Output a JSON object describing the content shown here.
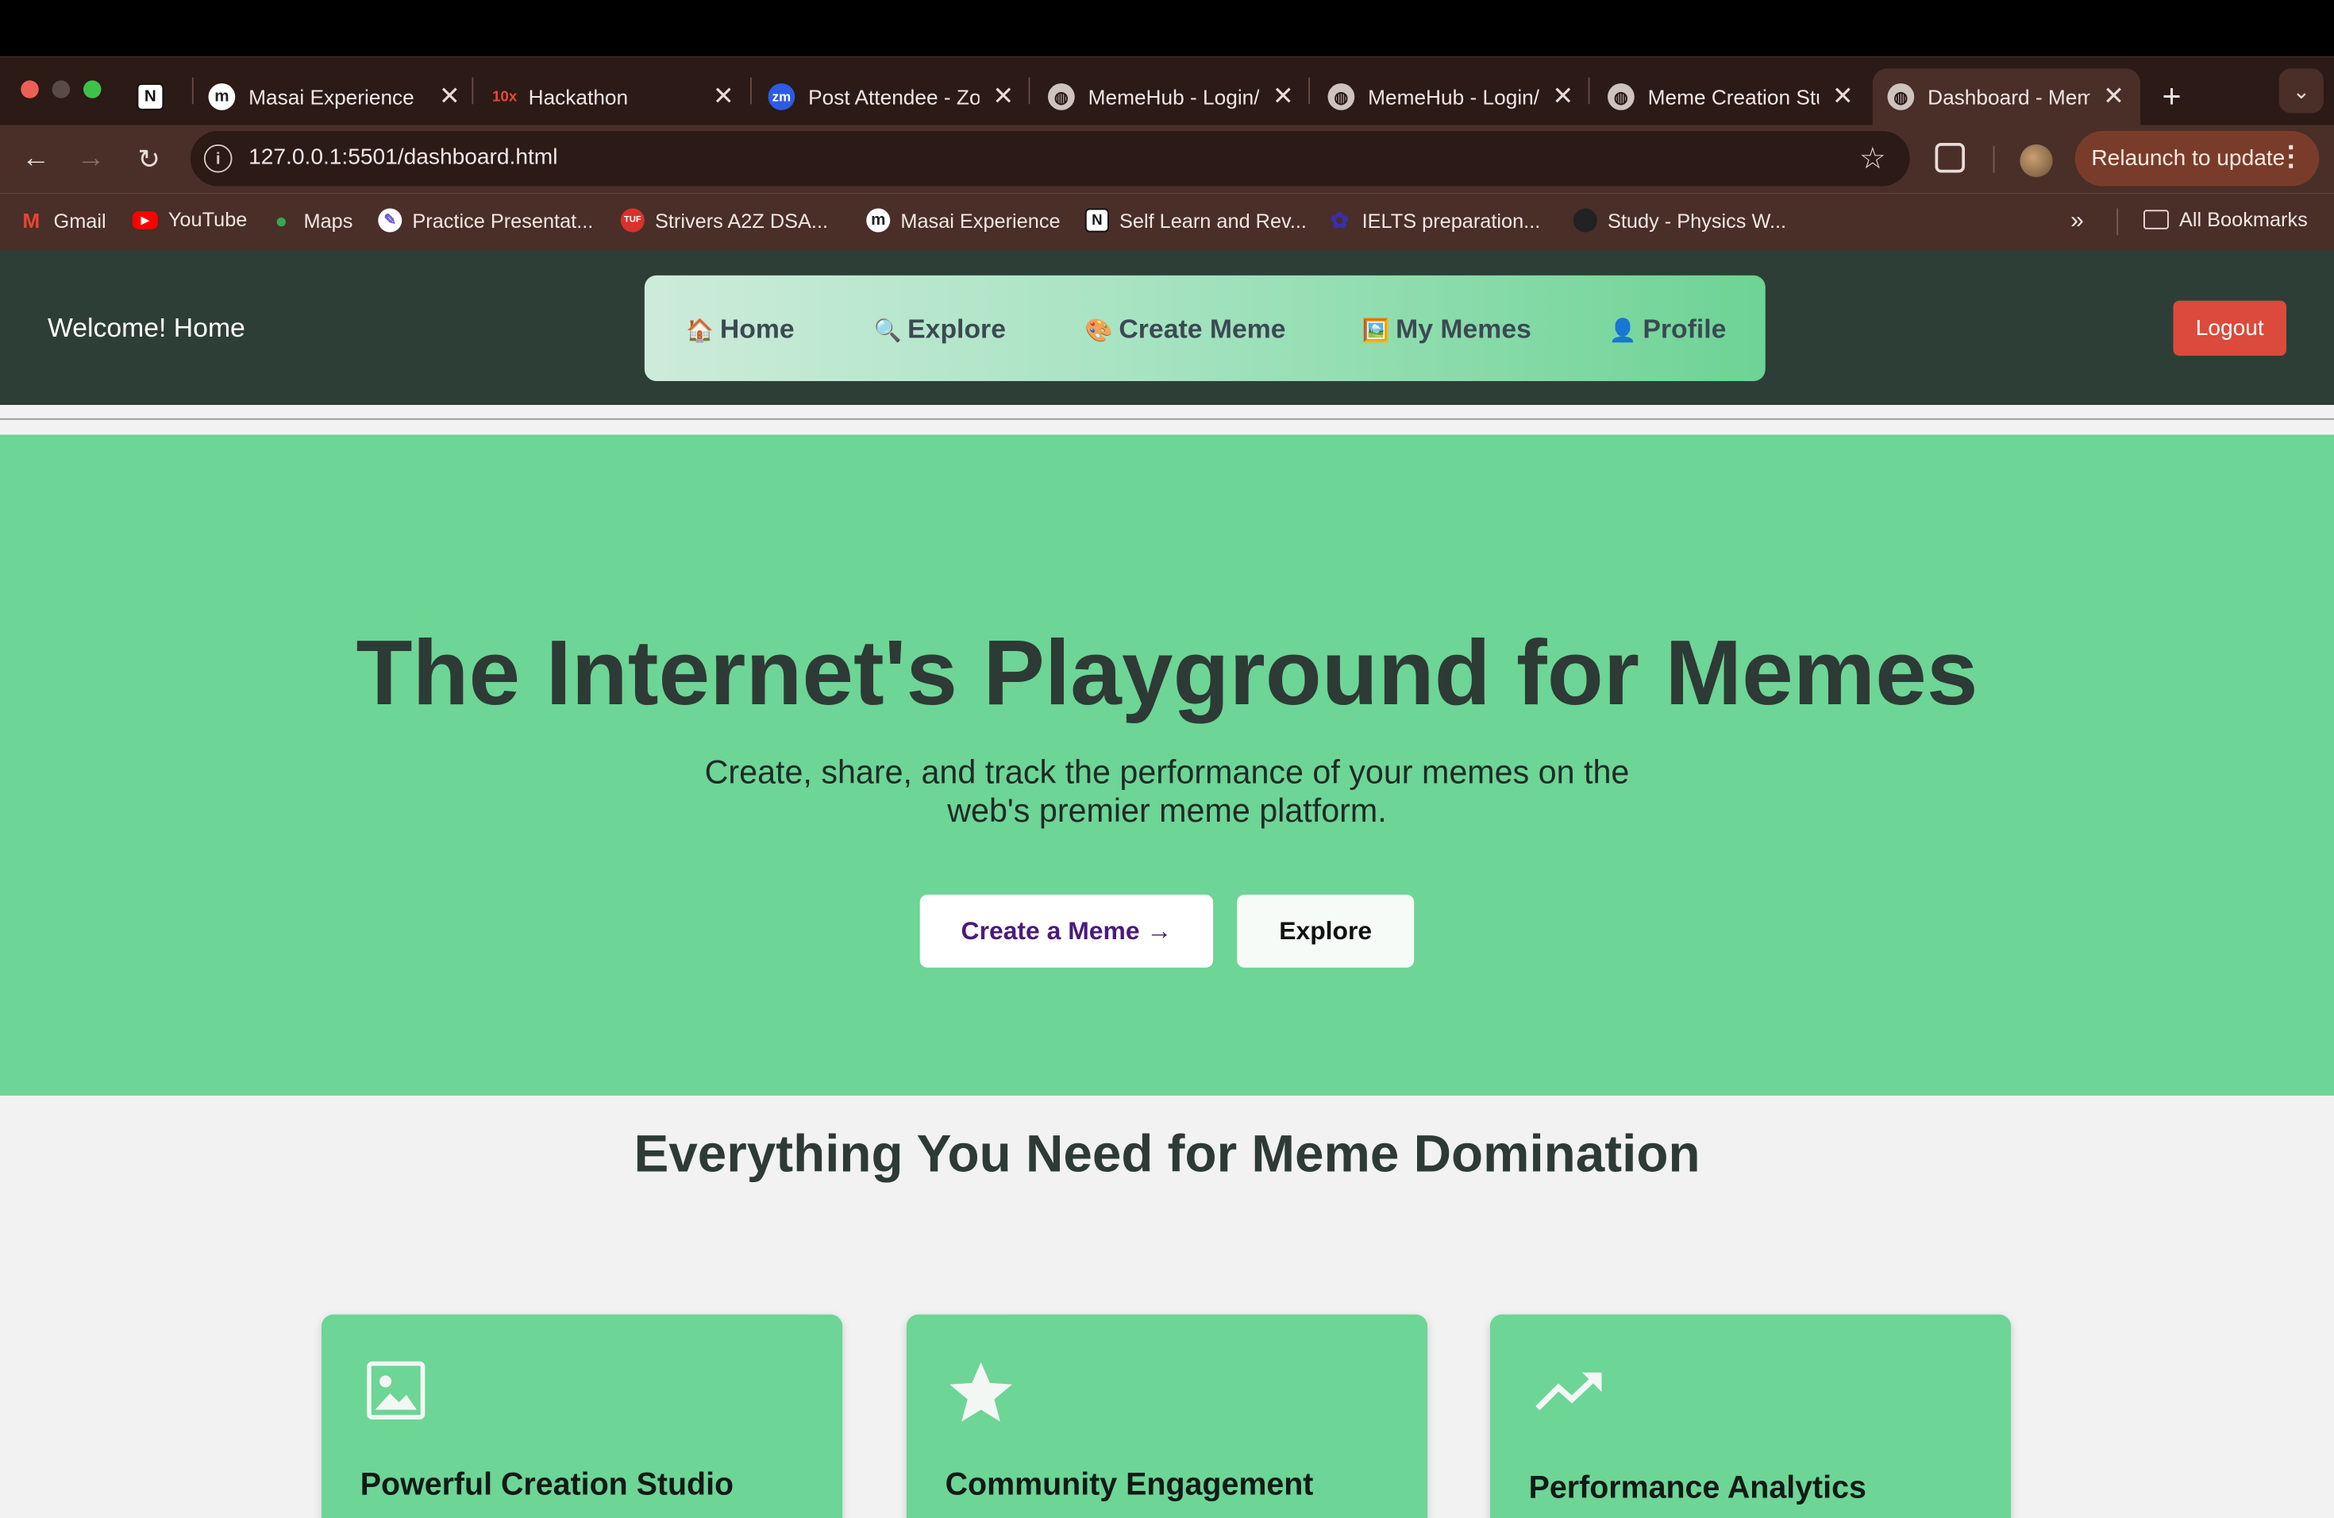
{
  "browser": {
    "tabs": [
      {
        "title": "",
        "icon": "notion-icon"
      },
      {
        "title": "Masai Experience",
        "icon": "masai-icon"
      },
      {
        "title": "Hackathon",
        "icon": "10x-icon",
        "icon_text": "10x"
      },
      {
        "title": "Post Attendee - Zo",
        "icon": "zoom-icon",
        "icon_text": "zm"
      },
      {
        "title": "MemeHub - Login/",
        "icon": "globe-icon"
      },
      {
        "title": "MemeHub - Login/",
        "icon": "globe-icon"
      },
      {
        "title": "Meme Creation Stu",
        "icon": "globe-icon"
      },
      {
        "title": "Dashboard - Meme",
        "icon": "globe-icon",
        "active": true
      }
    ],
    "new_tab_symbol": "+",
    "close_symbol": "✕",
    "url": "127.0.0.1:5501/dashboard.html",
    "relaunch_label": "Relaunch to update",
    "bookmarks": [
      {
        "label": "Gmail",
        "icon": "gmail-icon"
      },
      {
        "label": "YouTube",
        "icon": "youtube-icon"
      },
      {
        "label": "Maps",
        "icon": "maps-icon"
      },
      {
        "label": "Practice Presentat...",
        "icon": "practice-icon"
      },
      {
        "label": "Strivers A2Z DSA...",
        "icon": "tuf-icon",
        "icon_text": "TUF"
      },
      {
        "label": "Masai Experience",
        "icon": "masai-icon"
      },
      {
        "label": "Self Learn and Rev...",
        "icon": "notion-icon"
      },
      {
        "label": "IELTS preparation...",
        "icon": "ielts-icon"
      },
      {
        "label": "Study - Physics W...",
        "icon": "study-icon"
      }
    ],
    "bookmarks_overflow": "»",
    "all_bookmarks": "All Bookmarks"
  },
  "app": {
    "welcome": "Welcome! Home",
    "nav": [
      {
        "emoji": "🏠",
        "label": "Home"
      },
      {
        "emoji": "🔍",
        "label": "Explore"
      },
      {
        "emoji": "🎨",
        "label": "Create Meme"
      },
      {
        "emoji": "🖼️",
        "label": "My Memes"
      },
      {
        "emoji": "👤",
        "label": "Profile"
      }
    ],
    "logout": "Logout"
  },
  "hero": {
    "title": "The Internet's Playground for Memes",
    "subtitle": "Create, share, and track the performance of your memes on the web's premier meme platform.",
    "create_button": "Create a Meme →",
    "explore_button": "Explore"
  },
  "features": {
    "title": "Everything You Need for Meme Domination",
    "cards": [
      {
        "title": "Powerful Creation Studio",
        "icon": "image-icon"
      },
      {
        "title": "Community Engagement",
        "icon": "star-icon"
      },
      {
        "title": "Performance Analytics",
        "icon": "trending-up-icon"
      }
    ]
  },
  "colors": {
    "brand_green": "#6dd596",
    "header_bg": "#2d3e37",
    "logout_red": "#db4a3b",
    "create_button_text": "#4b1a7a"
  }
}
